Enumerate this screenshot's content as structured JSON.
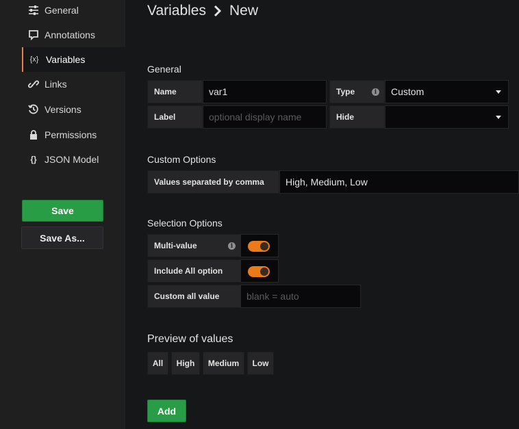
{
  "sidebar": {
    "items": [
      {
        "label": "General",
        "icon": "sliders-icon"
      },
      {
        "label": "Annotations",
        "icon": "comment-icon"
      },
      {
        "label": "Variables",
        "icon": "variable-icon",
        "icon_glyph": "{x}",
        "active": true
      },
      {
        "label": "Links",
        "icon": "link-icon"
      },
      {
        "label": "Versions",
        "icon": "history-icon"
      },
      {
        "label": "Permissions",
        "icon": "lock-icon"
      },
      {
        "label": "JSON Model",
        "icon": "json-icon",
        "icon_glyph": "{}"
      }
    ],
    "save_label": "Save",
    "save_as_label": "Save As..."
  },
  "header": {
    "title": "Variables",
    "subtitle": "New"
  },
  "general": {
    "section_title": "General",
    "name_label": "Name",
    "name_value": "var1",
    "type_label": "Type",
    "type_value": "Custom",
    "label_label": "Label",
    "label_placeholder": "optional display name",
    "hide_label": "Hide",
    "hide_value": ""
  },
  "custom_options": {
    "section_title": "Custom Options",
    "values_label": "Values separated by comma",
    "values_value": "High, Medium, Low"
  },
  "selection_options": {
    "section_title": "Selection Options",
    "multi_value_label": "Multi-value",
    "multi_value_on": true,
    "include_all_label": "Include All option",
    "include_all_on": true,
    "custom_all_label": "Custom all value",
    "custom_all_placeholder": "blank = auto"
  },
  "preview": {
    "title": "Preview of values",
    "values": [
      "All",
      "High",
      "Medium",
      "Low"
    ]
  },
  "add_label": "Add",
  "colors": {
    "accent": "#eb7b18",
    "primary_button": "#299c46",
    "background": "#161719"
  }
}
